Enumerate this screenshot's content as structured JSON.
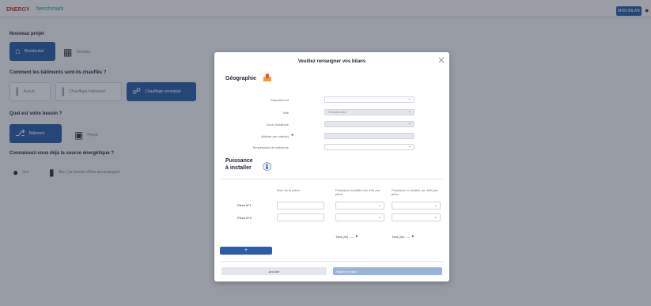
{
  "topbar": {
    "logo_primary": "ENERGY",
    "logo_secondary": "benchmark",
    "action_label": "MON BILAN",
    "icon": "user-icon"
  },
  "background": {
    "question_1": "Nouveau projet",
    "q1_options": [
      "Résidentiel",
      "Tertiaire"
    ],
    "question_2": "Comment les bâtiments sont-ils chauffés ?",
    "q2_options": [
      "Aucun",
      "Chauffage individuel",
      "Chauffage centralisé"
    ],
    "question_3": "Quel est votre besoin ?",
    "q3_options": [
      "Bâtiment",
      "Projet"
    ],
    "question_4": "Connaissez-vous déjà la source énergétique ?",
    "q4_options": [
      "Oui",
      "Non, j'ai besoin d'être accompagné"
    ]
  },
  "modal": {
    "title": "Veuillez renseigner vos bilans",
    "section_geo": "Géographie",
    "geo_fields": [
      {
        "label": "Département",
        "value": "",
        "disabled": false,
        "select": true
      },
      {
        "label": "Ville",
        "value": "Sélectionnez",
        "disabled": true,
        "select": true
      },
      {
        "label": "Zone climatique",
        "value": "",
        "disabled": true,
        "select": true
      },
      {
        "label": "Altitude (en mètres)",
        "value": "",
        "disabled": true,
        "select": false
      },
      {
        "label": "Température de référence",
        "value": "",
        "disabled": false,
        "select": false
      }
    ],
    "section_power": "Puissance à installer",
    "table_headers": [
      "Nom de la pièce",
      "Puissance installée (en kW) par pièce",
      "Puissance à installer (en kW) par pièce"
    ],
    "rows": [
      {
        "label": "Pièce N°1"
      },
      {
        "label": "Pièce N°2"
      }
    ],
    "total_installed": "Total (W) : —",
    "total_needed": "Total (W) : —",
    "add_label": "+",
    "cancel_label": "Annuler",
    "confirm_label": "Valider le bilan"
  },
  "colors": {
    "accent": "#2b5ea7",
    "overlay": "#1e2636",
    "disabled_button": "#9cb4d8"
  }
}
